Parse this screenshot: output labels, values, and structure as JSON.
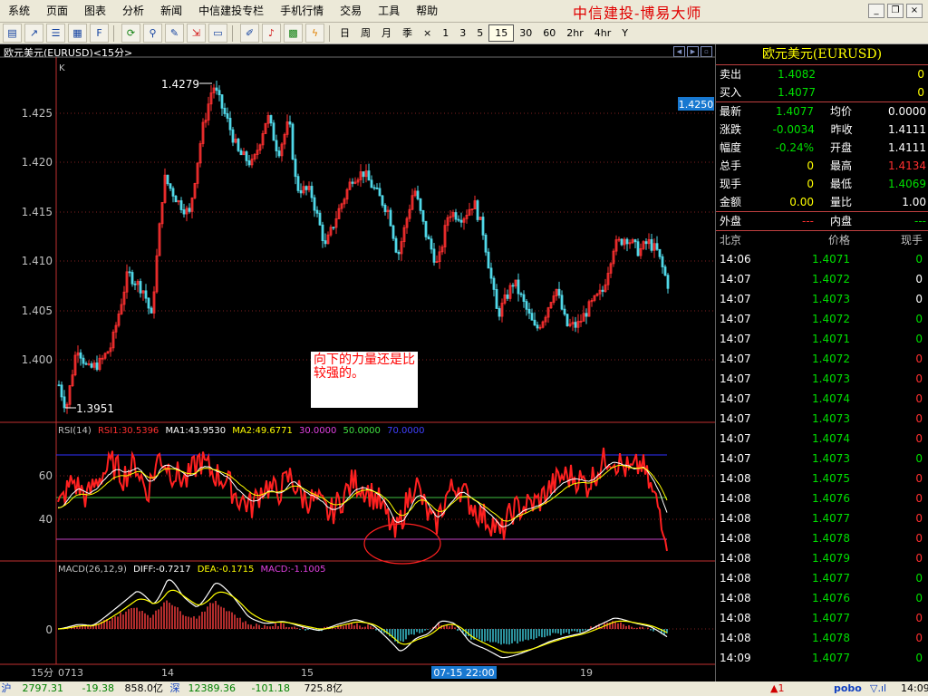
{
  "menu": {
    "items": [
      "系统",
      "页面",
      "图表",
      "分析",
      "新闻",
      "中信建投专栏",
      "手机行情",
      "交易",
      "工具",
      "帮助"
    ],
    "brand": "中信建投-博易大师"
  },
  "toolbar": {
    "periods": [
      "日",
      "周",
      "月",
      "季",
      "×",
      "1",
      "3",
      "5",
      "15",
      "30",
      "60",
      "2hr",
      "4hr",
      "Y"
    ],
    "active_period": "15",
    "icons": [
      "layout-icon",
      "line-chart-icon",
      "list-icon",
      "table-icon",
      "f10-icon",
      "refresh-icon",
      "zoom-in-icon",
      "draw-icon",
      "export-icon",
      "window-icon",
      "edit-icon",
      "alarm-icon",
      "grid-icon",
      "flash-icon"
    ]
  },
  "chart": {
    "title": "欧元美元(EURUSD)<15分>",
    "k_label": "K",
    "price_ticks": [
      "1.425",
      "1.420",
      "1.415",
      "1.410",
      "1.405",
      "1.400"
    ],
    "high_label": "1.4279",
    "low_label": "1.3951",
    "current_price": "1.4250",
    "rsi_header": {
      "name": "RSI(14)",
      "rsi1": "RSI1:30.5396",
      "ma1": "MA1:43.9530",
      "ma2": "MA2:49.6771",
      "l30": "30.0000",
      "l50": "50.0000",
      "l70": "70.0000"
    },
    "rsi_ticks": [
      "60",
      "40"
    ],
    "macd_header": {
      "name": "MACD(26,12,9)",
      "diff": "DIFF:-0.7217",
      "dea": "DEA:-0.1715",
      "macd": "MACD:-1.1005"
    },
    "macd_tick": "0",
    "period_label": "15分",
    "date_labels": [
      "0713",
      "14",
      "15",
      "19"
    ],
    "cursor_label": "07-15 22:00",
    "note": "向下的力量还是比较强的。",
    "colors": {
      "up": "#ff3030",
      "down": "#50d8e8",
      "ma1": "#ffffff",
      "ma2": "#ffff00"
    }
  },
  "quote": {
    "title": "欧元美元(EURUSD)",
    "sell": {
      "label": "卖出",
      "price": "1.4082",
      "vol": "0"
    },
    "buy": {
      "label": "买入",
      "price": "1.4077",
      "vol": "0"
    },
    "rows": [
      {
        "l1": "最新",
        "v1": "1.4077",
        "c1": "g",
        "l2": "均价",
        "v2": "0.0000",
        "c2": "w"
      },
      {
        "l1": "涨跌",
        "v1": "-0.0034",
        "c1": "g",
        "l2": "昨收",
        "v2": "1.4111",
        "c2": "w"
      },
      {
        "l1": "幅度",
        "v1": "-0.24%",
        "c1": "g",
        "l2": "开盘",
        "v2": "1.4111",
        "c2": "w"
      },
      {
        "l1": "总手",
        "v1": "0",
        "c1": "y",
        "l2": "最高",
        "v2": "1.4134",
        "c2": "r"
      },
      {
        "l1": "现手",
        "v1": "0",
        "c1": "y",
        "l2": "最低",
        "v2": "1.4069",
        "c2": "g"
      },
      {
        "l1": "金额",
        "v1": "0.00",
        "c1": "y",
        "l2": "量比",
        "v2": "1.00",
        "c2": "w"
      }
    ],
    "outer": {
      "label": "外盘",
      "value": "---"
    },
    "inner": {
      "label": "内盘",
      "value": "---"
    },
    "tick_headers": [
      "北京",
      "价格",
      "现手"
    ],
    "ticks": [
      {
        "t": "14:06",
        "p": "1.4071",
        "v": "0",
        "c": "g"
      },
      {
        "t": "14:07",
        "p": "1.4072",
        "v": "0",
        "c": "w"
      },
      {
        "t": "14:07",
        "p": "1.4073",
        "v": "0",
        "c": "w"
      },
      {
        "t": "14:07",
        "p": "1.4072",
        "v": "0",
        "c": "g"
      },
      {
        "t": "14:07",
        "p": "1.4071",
        "v": "0",
        "c": "g"
      },
      {
        "t": "14:07",
        "p": "1.4072",
        "v": "0",
        "c": "r"
      },
      {
        "t": "14:07",
        "p": "1.4073",
        "v": "0",
        "c": "r"
      },
      {
        "t": "14:07",
        "p": "1.4074",
        "v": "0",
        "c": "r"
      },
      {
        "t": "14:07",
        "p": "1.4073",
        "v": "0",
        "c": "r"
      },
      {
        "t": "14:07",
        "p": "1.4074",
        "v": "0",
        "c": "r"
      },
      {
        "t": "14:07",
        "p": "1.4073",
        "v": "0",
        "c": "g"
      },
      {
        "t": "14:08",
        "p": "1.4075",
        "v": "0",
        "c": "r"
      },
      {
        "t": "14:08",
        "p": "1.4076",
        "v": "0",
        "c": "r"
      },
      {
        "t": "14:08",
        "p": "1.4077",
        "v": "0",
        "c": "r"
      },
      {
        "t": "14:08",
        "p": "1.4078",
        "v": "0",
        "c": "r"
      },
      {
        "t": "14:08",
        "p": "1.4079",
        "v": "0",
        "c": "r"
      },
      {
        "t": "14:08",
        "p": "1.4077",
        "v": "0",
        "c": "g"
      },
      {
        "t": "14:08",
        "p": "1.4076",
        "v": "0",
        "c": "g"
      },
      {
        "t": "14:08",
        "p": "1.4077",
        "v": "0",
        "c": "r"
      },
      {
        "t": "14:08",
        "p": "1.4078",
        "v": "0",
        "c": "r"
      },
      {
        "t": "14:09",
        "p": "1.4077",
        "v": "0",
        "c": "g"
      }
    ]
  },
  "status": {
    "sh_label": "沪",
    "sh_index": "2797.31",
    "sh_change": "-19.38",
    "sh_amount": "858.0亿",
    "sz_label": "深",
    "sz_index": "12389.36",
    "sz_change": "-101.18",
    "sz_amount": "725.8亿",
    "alert": "▲1",
    "pobo": "pobo",
    "time": "14:09"
  }
}
